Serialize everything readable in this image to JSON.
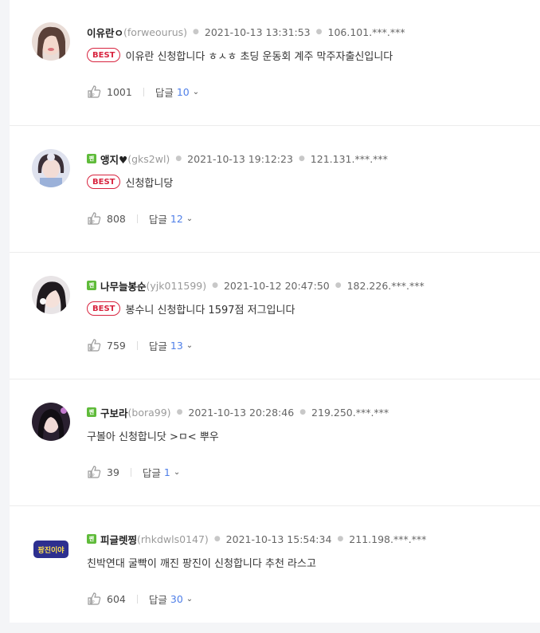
{
  "comments": [
    {
      "nickname": "이유란ㅇ",
      "user_id": "(forweourus)",
      "fan_badge": false,
      "date": "2021-10-13 13:31:53",
      "ip": "106.101.***.***",
      "best": true,
      "best_label": "BEST",
      "text": "이유란 신청합니다 ㅎㅅㅎ 초딩 운동회 계주 막주자출신입니다",
      "likes": "1001",
      "reply_label": "답글",
      "reply_count": "10"
    },
    {
      "nickname": "앵지♥",
      "user_id": "(gks2wl)",
      "fan_badge": true,
      "fan_badge_label": "팬",
      "date": "2021-10-13 19:12:23",
      "ip": "121.131.***.***",
      "best": true,
      "best_label": "BEST",
      "text": "신청합니당",
      "likes": "808",
      "reply_label": "답글",
      "reply_count": "12"
    },
    {
      "nickname": "나무늘봉순",
      "user_id": "(yjk011599)",
      "fan_badge": true,
      "fan_badge_label": "팬",
      "date": "2021-10-12 20:47:50",
      "ip": "182.226.***.***",
      "best": true,
      "best_label": "BEST",
      "text": "봉수니 신청합니다 1597점 저그입니다",
      "likes": "759",
      "reply_label": "답글",
      "reply_count": "13"
    },
    {
      "nickname": "구보라",
      "user_id": "(bora99)",
      "fan_badge": true,
      "fan_badge_label": "팬",
      "date": "2021-10-13 20:28:46",
      "ip": "219.250.***.***",
      "best": false,
      "text": "구볼아 신청합니닷 >ㅁ< 뿌우",
      "likes": "39",
      "reply_label": "답글",
      "reply_count": "1"
    },
    {
      "nickname": "피글렛찡",
      "user_id": "(rhkdwls0147)",
      "fan_badge": true,
      "fan_badge_label": "팬",
      "date": "2021-10-13 15:54:34",
      "ip": "211.198.***.***",
      "best": false,
      "text": "친박연대 굴빡이 깨진 팡진이 신청합니다 추천 라스고",
      "likes": "604",
      "reply_label": "답글",
      "reply_count": "30",
      "avatar_text": "팡진이야"
    }
  ],
  "colors": {
    "best_red": "#d8243f",
    "reply_blue": "#4f7fe8",
    "fan_green": "#5fbb3a"
  },
  "icons": {
    "like": "thumbs-up-icon",
    "reply_expand": "chevron-down-icon"
  }
}
